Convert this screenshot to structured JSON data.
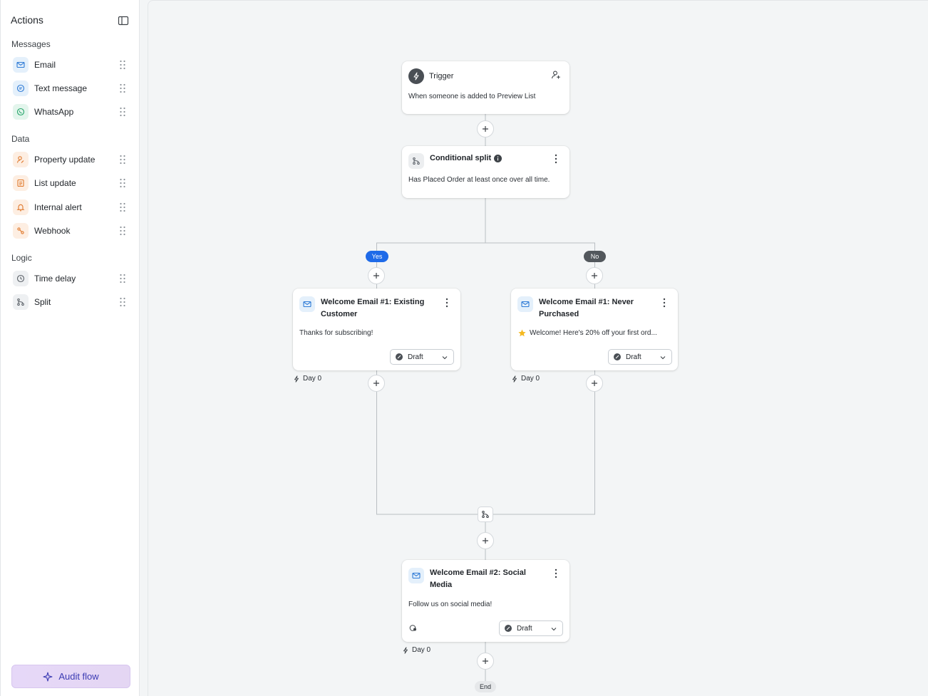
{
  "sidebar": {
    "title": "Actions",
    "sections": {
      "messages": "Messages",
      "data": "Data",
      "logic": "Logic"
    },
    "items": {
      "email": "Email",
      "text_message": "Text message",
      "whatsapp": "WhatsApp",
      "property_update": "Property update",
      "list_update": "List update",
      "internal_alert": "Internal alert",
      "webhook": "Webhook",
      "time_delay": "Time delay",
      "split": "Split"
    },
    "audit_label": "Audit flow"
  },
  "flow": {
    "trigger": {
      "title": "Trigger",
      "body": "When someone is added to Preview List"
    },
    "conditional_split": {
      "title": "Conditional split",
      "body": "Has Placed Order at least once over all time."
    },
    "branch_yes": "Yes",
    "branch_no": "No",
    "email_existing": {
      "title_line1": "Welcome Email #1: Existing",
      "title_line2": "Customer",
      "body": "Thanks for subscribing!",
      "status": "Draft",
      "day": "Day 0"
    },
    "email_never": {
      "title_line1": "Welcome Email #1: Never",
      "title_line2": "Purchased",
      "body": "Welcome! Here's 20% off your first ord...",
      "status": "Draft",
      "day": "Day 0"
    },
    "email_social": {
      "title_line1": "Welcome Email #2: Social",
      "title_line2": "Media",
      "body": "Follow us on social media!",
      "status": "Draft",
      "day": "Day 0"
    },
    "end_label": "End"
  },
  "colors": {
    "accent_blue": "#1e6ae8",
    "no_pill": "#52575c",
    "audit_text": "#3b3bb3"
  }
}
